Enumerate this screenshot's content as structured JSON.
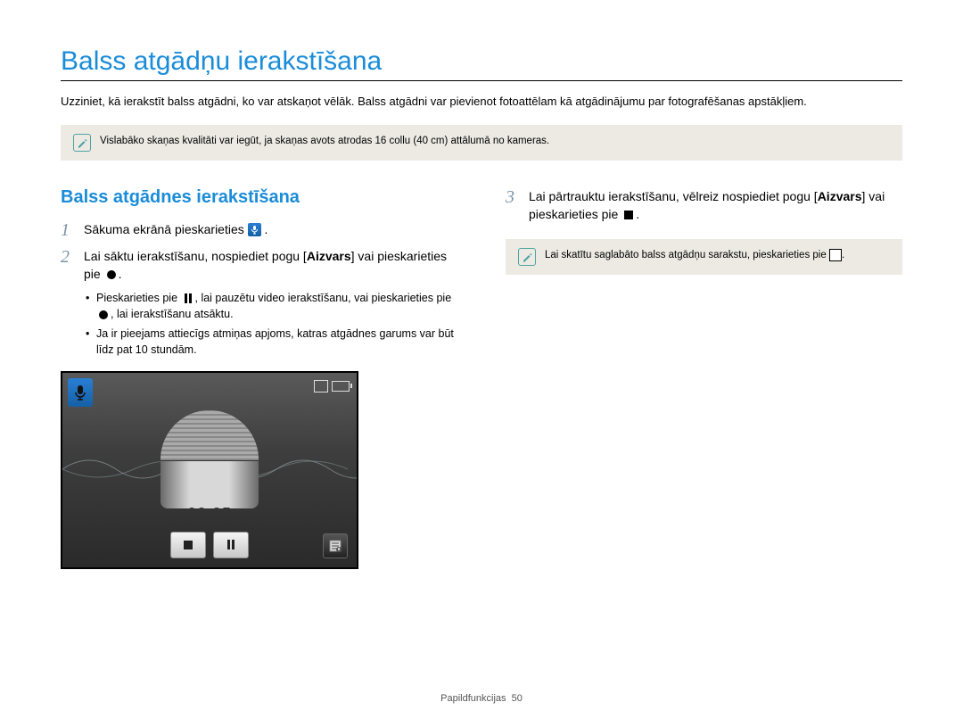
{
  "title": "Balss atgādņu ierakstīšana",
  "intro": "Uzziniet, kā ierakstīt balss atgādni, ko var atskaņot vēlāk. Balss atgādni var pievienot fotoattēlam kā atgādinājumu par fotografēšanas apstākļiem.",
  "note1": "Vislabāko skaņas kvalitāti var iegūt, ja skaņas avots atrodas 16 collu (40 cm) attālumā no kameras.",
  "section_heading": "Balss atgādnes ierakstīšana",
  "step1": {
    "num": "1",
    "text_a": "Sākuma ekrānā pieskarieties ",
    "text_b": "."
  },
  "step2": {
    "num": "2",
    "text_a": "Lai sāktu ierakstīšanu, nospiediet pogu [",
    "bold": "Aizvars",
    "text_b": "] vai pieskarieties pie ",
    "text_c": ".",
    "bullet1_a": "Pieskarieties pie ",
    "bullet1_b": ", lai pauzētu video ierakstīšanu, vai pieskarieties pie ",
    "bullet1_c": ", lai ierakstīšanu atsāktu.",
    "bullet2": "Ja ir pieejams attiecīgs atmiņas apjoms, katras atgādnes garums var būt līdz pat 10 stundām."
  },
  "step3": {
    "num": "3",
    "text_a": "Lai pārtrauktu ierakstīšanu, vēlreiz nospiediet pogu [",
    "bold": "Aizvars",
    "text_b": "] vai pieskarieties pie ",
    "text_c": "."
  },
  "note2_a": "Lai skatītu saglabāto balss atgādņu sarakstu, pieskarieties pie ",
  "note2_b": ".",
  "recorder": {
    "timer": "00:05"
  },
  "footer": {
    "section": "Papildfunkcijas",
    "page": "50"
  }
}
